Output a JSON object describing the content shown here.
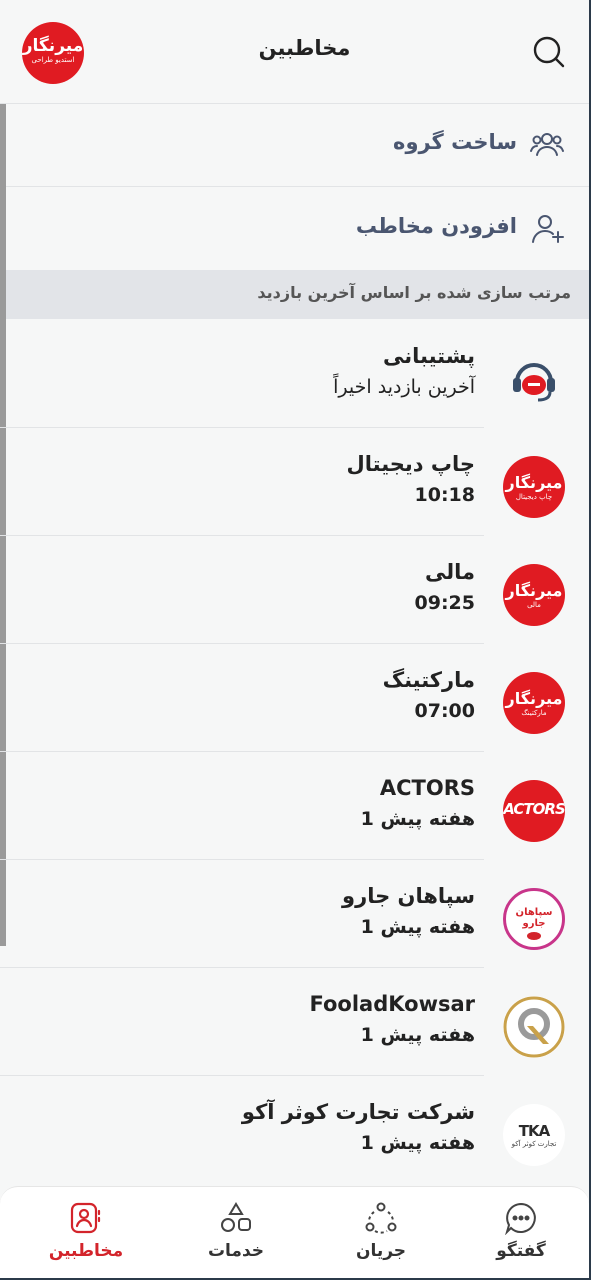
{
  "header": {
    "title": "مخاطبین",
    "logo_text": "میرنگار",
    "logo_sub": "استدیو طراحی",
    "search_icon": "search-icon"
  },
  "actions": [
    {
      "label": "ساخت گروه",
      "icon": "group-icon"
    },
    {
      "label": "افزودن مخاطب",
      "icon": "add-user-icon"
    }
  ],
  "section_title": "مرتب سازی شده بر اساس آخرین بازدید",
  "contacts": [
    {
      "name": "پشتیبانی",
      "sub": "آخرین بازدید اخیراً",
      "avatar": "support-headset-icon"
    },
    {
      "name": "چاپ دیجیتال",
      "sub": "10:18",
      "avatar_text": "میرنگار",
      "avatar_sub": "چاپ دیجیتال"
    },
    {
      "name": "مالی",
      "sub": "09:25",
      "avatar_text": "میرنگار",
      "avatar_sub": "مالی"
    },
    {
      "name": "مارکتینگ",
      "sub": "07:00",
      "avatar_text": "میرنگار",
      "avatar_sub": "مارکتینگ"
    },
    {
      "name": "ACTORS",
      "sub": "1 هفته پیش",
      "avatar_text": "ACTORS"
    },
    {
      "name": "سپاهان جارو",
      "sub": "1 هفته پیش",
      "avatar_text": "سپاهان جارو"
    },
    {
      "name": "FooladKowsar",
      "sub": "1 هفته پیش",
      "avatar": "fooladkowsar-logo"
    },
    {
      "name": "شرکت تجارت کوثر آکو",
      "sub": "1 هفته پیش",
      "avatar_text": "TKA",
      "avatar_sub": "تجارت کوثر آکو"
    }
  ],
  "nav": [
    {
      "label": "گفتگو",
      "icon": "chat-icon"
    },
    {
      "label": "جریان",
      "icon": "flow-icon"
    },
    {
      "label": "خدمات",
      "icon": "services-icon"
    },
    {
      "label": "مخاطبین",
      "icon": "contacts-icon",
      "active": true
    }
  ],
  "colors": {
    "accent": "#d3242b",
    "brand_red": "#e01b22",
    "section_bg": "#e2e4e8"
  }
}
